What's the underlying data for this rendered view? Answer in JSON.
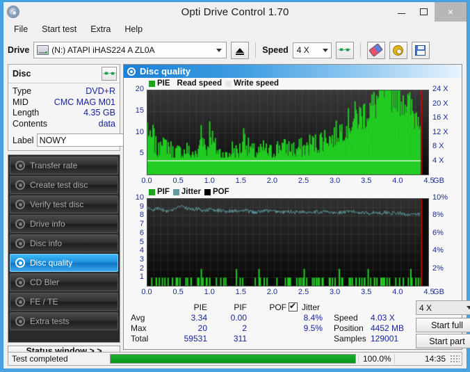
{
  "window": {
    "title": "Opti Drive Control 1.70",
    "app_icon": "disc-icon",
    "minimize": "–",
    "maximize": "□",
    "close": "×"
  },
  "menu": {
    "items": [
      "File",
      "Start test",
      "Extra",
      "Help"
    ]
  },
  "toolbar": {
    "drive_label": "Drive",
    "drive_value": "(N:)  ATAPI iHAS224  A ZL0A",
    "eject_title": "Eject",
    "speed_label": "Speed",
    "speed_value": "4 X",
    "icons": [
      "refresh-icon",
      "eraser-icon",
      "settings-icon",
      "save-icon"
    ]
  },
  "disc": {
    "title": "Disc",
    "refresh_icon": "refresh-icon",
    "rows": [
      {
        "key": "Type",
        "value": "DVD+R"
      },
      {
        "key": "MID",
        "value": "CMC MAG M01"
      },
      {
        "key": "Length",
        "value": "4.35 GB"
      },
      {
        "key": "Contents",
        "value": "data"
      }
    ],
    "label_key": "Label",
    "label_value": "NOWY",
    "label_button_icon": "cd-icon"
  },
  "nav": {
    "items": [
      {
        "label": "Transfer rate",
        "active": false
      },
      {
        "label": "Create test disc",
        "active": false
      },
      {
        "label": "Verify test disc",
        "active": false
      },
      {
        "label": "Drive info",
        "active": false
      },
      {
        "label": "Disc info",
        "active": false
      },
      {
        "label": "Disc quality",
        "active": true
      },
      {
        "label": "CD Bler",
        "active": false
      },
      {
        "label": "FE / TE",
        "active": false
      },
      {
        "label": "Extra tests",
        "active": false
      }
    ],
    "status_window": "Status window > >"
  },
  "panel": {
    "title": "Disc quality",
    "icon": "disc-quality-icon"
  },
  "stats": {
    "col_headers": [
      "PIE",
      "PIF",
      "POF",
      "Jitter"
    ],
    "row_headers": [
      "Avg",
      "Max",
      "Total"
    ],
    "jitter_checked": true,
    "pie": {
      "avg": "3.34",
      "max": "20",
      "total": "59531"
    },
    "pif": {
      "avg": "0.00",
      "max": "2",
      "total": "311"
    },
    "pof": {
      "avg": "",
      "max": "",
      "total": ""
    },
    "jitter": {
      "avg": "8.4%",
      "max": "9.5%",
      "total": ""
    },
    "speed_key": "Speed",
    "speed_value": "4.03 X",
    "position_key": "Position",
    "position_value": "4452 MB",
    "samples_key": "Samples",
    "samples_value": "129001",
    "speed_select": "4 X",
    "start_full": "Start full",
    "start_part": "Start part"
  },
  "statusbar": {
    "text": "Test completed",
    "percent_label": "100.0%",
    "percent": 100,
    "time": "14:35"
  },
  "colors": {
    "pie_green": "#22cc22",
    "jitter_teal": "#5f9ea0",
    "pof_black": "#000000",
    "marker_red": "#ee0000",
    "plot_bg": "#0a0a0a",
    "accent_blue": "#1b7fd4",
    "tick_text": "#1c2a9b"
  },
  "chart_data": [
    {
      "type": "area",
      "name": "pie-chart",
      "title": "PIE",
      "legend": [
        {
          "label": "PIE",
          "color": "#1ba51b"
        },
        {
          "label": "Read speed",
          "color": null
        },
        {
          "label": "Write speed",
          "color": "#e8e8e8"
        }
      ],
      "xlabel": "GB",
      "xlim": [
        0.0,
        4.5
      ],
      "xticks": [
        "0.0",
        "0.5",
        "1.0",
        "1.5",
        "2.0",
        "2.5",
        "3.0",
        "3.5",
        "4.0",
        "4.5"
      ],
      "ylabel": "PIE",
      "ylim": [
        0,
        20
      ],
      "yticks": [
        "5",
        "10",
        "15",
        "20"
      ],
      "y2label": "X",
      "y2lim": [
        0,
        24
      ],
      "y2ticks": [
        "4 X",
        "8 X",
        "12 X",
        "16 X",
        "20 X",
        "24 X"
      ],
      "grid": true,
      "marker_x": 4.38,
      "read_speed_line": 4.03,
      "x": [
        0.0,
        0.05,
        0.09,
        0.14,
        0.18,
        0.23,
        0.27,
        0.32,
        0.36,
        0.41,
        0.45,
        0.5,
        0.55,
        0.59,
        0.64,
        0.68,
        0.73,
        0.77,
        0.82,
        0.86,
        0.91,
        0.95,
        1.0,
        1.05,
        1.09,
        1.14,
        1.18,
        1.23,
        1.27,
        1.32,
        1.36,
        1.41,
        1.45,
        1.5,
        1.55,
        1.59,
        1.64,
        1.68,
        1.73,
        1.77,
        1.82,
        1.86,
        1.91,
        1.95,
        2.0,
        2.05,
        2.09,
        2.14,
        2.18,
        2.23,
        2.27,
        2.32,
        2.36,
        2.41,
        2.45,
        2.5,
        2.55,
        2.59,
        2.64,
        2.68,
        2.73,
        2.77,
        2.82,
        2.86,
        2.91,
        2.95,
        3.0,
        3.05,
        3.09,
        3.14,
        3.18,
        3.23,
        3.27,
        3.32,
        3.36,
        3.41,
        3.45,
        3.5,
        3.55,
        3.59,
        3.64,
        3.68,
        3.73,
        3.77,
        3.82,
        3.86,
        3.91,
        3.95,
        4.0,
        4.05,
        4.09,
        4.14,
        4.18,
        4.23,
        4.27,
        4.32,
        4.36
      ],
      "values": [
        11,
        7,
        9,
        6,
        5,
        10,
        6,
        7,
        6,
        5,
        5,
        5,
        5,
        5,
        6,
        4,
        5,
        4,
        5,
        11,
        7,
        5,
        11,
        7,
        6,
        5,
        5,
        4,
        4,
        5,
        6,
        5,
        5,
        6,
        10,
        6,
        6,
        5,
        5,
        5,
        5,
        6,
        5,
        5,
        5,
        6,
        6,
        7,
        6,
        6,
        6,
        6,
        5,
        6,
        6,
        6,
        6,
        7,
        7,
        7,
        7,
        8,
        8,
        9,
        8,
        8,
        9,
        10,
        10,
        11,
        11,
        12,
        12,
        13,
        13,
        13,
        14,
        14,
        15,
        15,
        16,
        17,
        18,
        19,
        20,
        18,
        19,
        20,
        19,
        17,
        18,
        16,
        15,
        14,
        13,
        15,
        13
      ]
    },
    {
      "type": "line",
      "name": "pif-jitter-chart",
      "legend": [
        {
          "label": "PIF",
          "color": "#1ba51b"
        },
        {
          "label": "Jitter",
          "color": "#5f9ea0"
        },
        {
          "label": "POF",
          "color": "#000000"
        }
      ],
      "xlabel": "GB",
      "xlim": [
        0.0,
        4.5
      ],
      "xticks": [
        "0.0",
        "0.5",
        "1.0",
        "1.5",
        "2.0",
        "2.5",
        "3.0",
        "3.5",
        "4.0",
        "4.5"
      ],
      "ylim": [
        0,
        10
      ],
      "yticks": [
        "1",
        "2",
        "3",
        "4",
        "5",
        "6",
        "7",
        "8",
        "9",
        "10"
      ],
      "y2label": "%",
      "y2lim": [
        0,
        10
      ],
      "y2ticks": [
        "2%",
        "4%",
        "6%",
        "8%",
        "10%"
      ],
      "grid": true,
      "marker_x": 4.38,
      "series": [
        {
          "name": "Jitter",
          "color": "#5f9ea0",
          "x": [
            0.0,
            0.09,
            0.18,
            0.27,
            0.36,
            0.45,
            0.55,
            0.64,
            0.73,
            0.82,
            0.91,
            1.0,
            1.09,
            1.18,
            1.27,
            1.36,
            1.45,
            1.55,
            1.64,
            1.73,
            1.82,
            1.91,
            2.0,
            2.09,
            2.18,
            2.27,
            2.36,
            2.45,
            2.55,
            2.64,
            2.73,
            2.82,
            2.91,
            3.0,
            3.09,
            3.18,
            3.27,
            3.36,
            3.45,
            3.55,
            3.64,
            3.73,
            3.82,
            3.91,
            4.0,
            4.09,
            4.18,
            4.27,
            4.36
          ],
          "values": [
            8.9,
            8.7,
            8.8,
            8.6,
            8.5,
            8.9,
            9.2,
            8.8,
            8.7,
            8.8,
            8.6,
            8.7,
            8.6,
            8.6,
            8.5,
            8.6,
            8.5,
            8.6,
            8.5,
            8.4,
            8.5,
            8.6,
            8.5,
            8.5,
            8.4,
            8.5,
            8.4,
            8.5,
            8.4,
            8.5,
            8.4,
            8.5,
            8.4,
            8.3,
            8.4,
            8.4,
            8.5,
            8.4,
            8.4,
            8.3,
            8.4,
            8.3,
            8.4,
            8.3,
            8.3,
            8.2,
            8.2,
            8.1,
            8.2
          ]
        },
        {
          "name": "PIF",
          "color": "#22cc22",
          "x": [
            0.07,
            0.14,
            0.19,
            0.24,
            0.28,
            0.33,
            0.4,
            0.46,
            0.52,
            0.64,
            0.7,
            0.82,
            0.86,
            0.94,
            0.95,
            1.1,
            1.22,
            1.42,
            1.48,
            1.52,
            1.72,
            1.78,
            1.8,
            2.2,
            2.24,
            2.28,
            2.42,
            2.5,
            2.54,
            2.66,
            2.72,
            2.8,
            2.95,
            3.06,
            3.1,
            3.24,
            3.38,
            3.42,
            3.46,
            3.52,
            3.56,
            3.62,
            3.74,
            3.78,
            3.82,
            3.86,
            3.96,
            4.02,
            4.08,
            4.16,
            4.2,
            4.28,
            4.32,
            4.36
          ],
          "values": [
            1,
            1,
            1,
            1,
            1,
            1,
            1,
            1,
            1,
            1,
            1,
            1,
            2,
            1,
            1,
            1,
            1,
            2,
            1,
            1,
            1,
            2,
            1,
            1,
            1,
            1,
            1,
            2,
            1,
            1,
            1,
            1,
            1,
            2,
            1,
            1,
            1,
            1,
            1,
            2,
            1,
            1,
            1,
            1,
            1,
            1,
            1,
            1,
            1,
            1,
            2,
            1,
            1,
            1
          ]
        }
      ]
    }
  ]
}
